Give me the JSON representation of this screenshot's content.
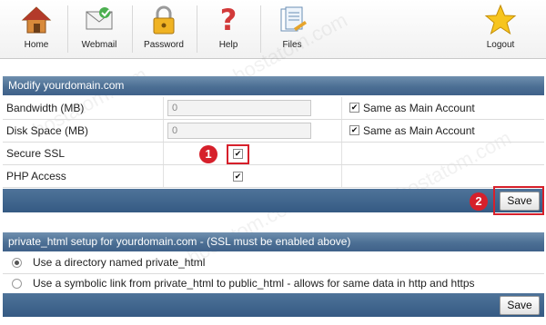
{
  "toolbar": {
    "home": "Home",
    "webmail": "Webmail",
    "password": "Password",
    "help": "Help",
    "files": "Files",
    "logout": "Logout"
  },
  "modify": {
    "title": "Modify yourdomain.com",
    "bandwidth_label": "Bandwidth (MB)",
    "bandwidth_value": "0",
    "disk_label": "Disk Space (MB)",
    "disk_value": "0",
    "same_label": "Same as Main Account",
    "ssl_label": "Secure SSL",
    "php_label": "PHP Access",
    "checks": {
      "bandwidth_same": true,
      "disk_same": true,
      "ssl": true,
      "php": true
    },
    "save_label": "Save"
  },
  "callouts": {
    "one": "1",
    "two": "2",
    "color": "#d6202b"
  },
  "private_html": {
    "title": "private_html setup for yourdomain.com - (SSL must be enabled above)",
    "option1": "Use a directory named private_html",
    "option2": "Use a symbolic link from private_html to public_html - allows for same data in http and https",
    "selected": 1,
    "save_label": "Save"
  },
  "watermark": "hostatom.com",
  "colors": {
    "header_blue": "#4c6f94",
    "accent_red": "#d6202b"
  }
}
